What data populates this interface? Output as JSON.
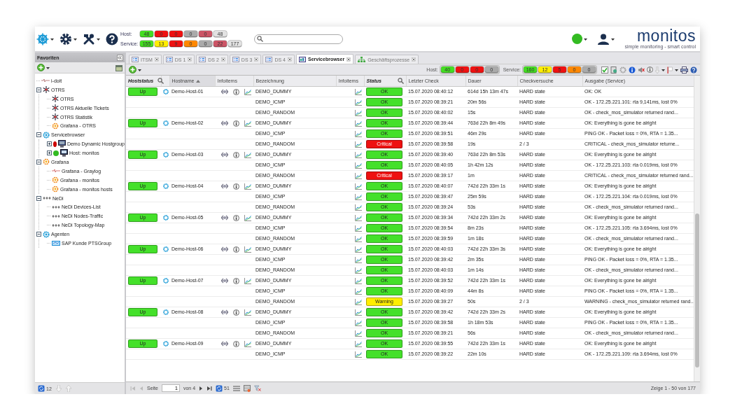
{
  "header": {
    "host_label": "Host:",
    "host_counters": [
      {
        "value": "48",
        "color": "#44dd22"
      },
      {
        "value": "0",
        "color": "#ee1111"
      },
      {
        "value": "0",
        "color": "#ee1111"
      },
      {
        "value": "0",
        "color": "#aaaaaa"
      },
      {
        "value": "0",
        "color": "#cc5566"
      },
      {
        "value": "48",
        "color": "#e2e2e2"
      }
    ],
    "service_label": "Service:",
    "service_counters": [
      {
        "value": "155",
        "color": "#44dd22"
      },
      {
        "value": "13",
        "color": "#ffee00"
      },
      {
        "value": "9",
        "color": "#ee1111"
      },
      {
        "value": "0",
        "color": "#ff8800"
      },
      {
        "value": "0",
        "color": "#aaaaaa"
      },
      {
        "value": "22",
        "color": "#cc5566"
      },
      {
        "value": "177",
        "color": "#e2e2e2"
      }
    ],
    "status": {
      "color": "#33bb22"
    },
    "logo": {
      "name": "monitos",
      "tagline": "simple monitoring - smart control"
    }
  },
  "sidebar": {
    "title": "Favoriten",
    "tree": [
      {
        "label": "i-doit",
        "kind": "idoit"
      },
      {
        "label": "OTRS",
        "kind": "otrs",
        "expanded": true,
        "children": [
          {
            "label": "OTRS",
            "kind": "otrs"
          },
          {
            "label": "OTRS Aktuelle Tickets",
            "kind": "otrs"
          },
          {
            "label": "OTRS Statistik",
            "kind": "otrs"
          },
          {
            "label": "Grafana - OTRS",
            "kind": "grafana"
          }
        ]
      },
      {
        "label": "Servicebrowser",
        "kind": "servicebrowser",
        "expanded": true,
        "children": [
          {
            "label": "Demo Dynamic Hostgroup",
            "kind": "hostgroup",
            "expanded": false,
            "color": "#cc0000"
          },
          {
            "label": "Host: monitos",
            "kind": "host",
            "expanded": false,
            "color": "#33bb22"
          }
        ]
      },
      {
        "label": "Grafana",
        "kind": "grafana",
        "expanded": true,
        "children": [
          {
            "label": "Grafana - Graylog",
            "kind": "graylog"
          },
          {
            "label": "Grafana - monitos",
            "kind": "grafana"
          },
          {
            "label": "Grafana - monitos hosts",
            "kind": "grafana"
          }
        ]
      },
      {
        "label": "NeDi",
        "kind": "nedi",
        "expanded": true,
        "children": [
          {
            "label": "NeDi Devices-List",
            "kind": "nedi"
          },
          {
            "label": "NeDi Nodes-Traffic",
            "kind": "nedi"
          },
          {
            "label": "NeDi Topology-Map",
            "kind": "nedi"
          }
        ]
      },
      {
        "label": "Agenten",
        "kind": "servicebrowser",
        "expanded": true,
        "children": [
          {
            "label": "SAP Kunde PTSGroup",
            "kind": "sap"
          }
        ]
      }
    ],
    "footer_count": "12"
  },
  "tabs": [
    {
      "label": "ITSM",
      "kind": "dashboard",
      "selected": false
    },
    {
      "label": "DS 1",
      "kind": "dashboard",
      "selected": false
    },
    {
      "label": "DS 2",
      "kind": "dashboard",
      "selected": false
    },
    {
      "label": "DS 3",
      "kind": "dashboard",
      "selected": false
    },
    {
      "label": "DS 4",
      "kind": "dashboard",
      "selected": false
    },
    {
      "label": "Servicebrowser",
      "kind": "servicebrowser",
      "selected": true
    },
    {
      "label": "Geschäftsprozesse",
      "kind": "process",
      "selected": false
    }
  ],
  "toolbar": {
    "host_label": "Host:",
    "host_counters": [
      {
        "value": "40",
        "color": "#44dd22"
      },
      {
        "value": "0",
        "color": "#ee1111"
      },
      {
        "value": "0",
        "color": "#ee1111"
      },
      {
        "value": "0",
        "color": "#aaaaaa"
      }
    ],
    "service_label": "Service:",
    "service_counters": [
      {
        "value": "160",
        "color": "#44dd22"
      },
      {
        "value": "12",
        "color": "#ffee00"
      },
      {
        "value": "5",
        "color": "#ee1111"
      },
      {
        "value": "0",
        "color": "#ff8800"
      },
      {
        "value": "0",
        "color": "#aaaaaa"
      }
    ]
  },
  "table": {
    "columns": [
      {
        "label": "Hoststatus",
        "filtered": true
      },
      {},
      {
        "label": "Hostname",
        "sorted": true
      },
      {
        "label": "Infoitems"
      },
      {
        "label": "Bezeichnung"
      },
      {
        "label": "Infoitems"
      },
      {
        "label": "Status",
        "filtered": true
      },
      {
        "label": "Letzter Check"
      },
      {
        "label": "Dauer"
      },
      {
        "label": "Checkversuche"
      },
      {
        "label": "Ausgabe (Service)"
      }
    ],
    "hosts": [
      {
        "status": "Up",
        "color": "#44e02a",
        "name": "Demo-Host-01",
        "services": [
          {
            "name": "DEMO_DUMMY",
            "status": "OK",
            "color": "#44e02a",
            "last_check": "15.07.2020 08:40:12",
            "duration": "614d 15h 13m 47s",
            "attempts": "HARD state",
            "output": "OK: OK"
          },
          {
            "name": "DEMO_ICMP",
            "status": "OK",
            "color": "#44e02a",
            "last_check": "15.07.2020 08:39:21",
            "duration": "20m 56s",
            "attempts": "HARD state",
            "output": "OK - 172.25.221.101: rta 9,141ms, lost 0%"
          },
          {
            "name": "DEMO_RANDOM",
            "status": "OK",
            "color": "#44e02a",
            "last_check": "15.07.2020 08:40:02",
            "duration": "15s",
            "attempts": "HARD state",
            "output": "OK - check_mos_simulator returned rand..."
          }
        ]
      },
      {
        "status": "Up",
        "color": "#44e02a",
        "name": "Demo-Host-02",
        "services": [
          {
            "name": "DEMO_DUMMY",
            "status": "OK",
            "color": "#44e02a",
            "last_check": "15.07.2020 08:39:44",
            "duration": "763d 22h 8m 49s",
            "attempts": "HARD state",
            "output": "OK: Everything is gone be alright"
          },
          {
            "name": "DEMO_ICMP",
            "status": "OK",
            "color": "#44e02a",
            "last_check": "15.07.2020 08:39:51",
            "duration": "46m 29s",
            "attempts": "HARD state",
            "output": "PING OK - Packet loss = 0%, RTA = 1.35..."
          },
          {
            "name": "DEMO_RANDOM",
            "status": "Critical",
            "color": "#ee1111",
            "last_check": "15.07.2020 08:39:58",
            "duration": "19s",
            "attempts": "2 / 3",
            "output": "CRITICAL - check_mos_simulator returne..."
          }
        ]
      },
      {
        "status": "Up",
        "color": "#44e02a",
        "name": "Demo-Host-03",
        "services": [
          {
            "name": "DEMO_DUMMY",
            "status": "OK",
            "color": "#44e02a",
            "last_check": "15.07.2020 08:39:40",
            "duration": "763d 22h 8m 53s",
            "attempts": "HARD state",
            "output": "OK: Everything is gone be alright"
          },
          {
            "name": "DEMO_ICMP",
            "status": "OK",
            "color": "#44e02a",
            "last_check": "15.07.2020 08:40:05",
            "duration": "1h 42m 12s",
            "attempts": "HARD state",
            "output": "OK - 172.25.221.103: rta 0.019ms, lost 0%"
          },
          {
            "name": "DEMO_RANDOM",
            "status": "Critical",
            "color": "#ee1111",
            "last_check": "15.07.2020 08:39:17",
            "duration": "1m",
            "attempts": "HARD state",
            "output": "CRITICAL - check_mos_simulator returned rand..."
          }
        ]
      },
      {
        "status": "Up",
        "color": "#44e02a",
        "name": "Demo-Host-04",
        "services": [
          {
            "name": "DEMO_DUMMY",
            "status": "OK",
            "color": "#44e02a",
            "last_check": "15.07.2020 08:40:07",
            "duration": "742d 22h 33m 1s",
            "attempts": "HARD state",
            "output": "OK: Everything is gone be alright"
          },
          {
            "name": "DEMO_ICMP",
            "status": "OK",
            "color": "#44e02a",
            "last_check": "15.07.2020 08:39:47",
            "duration": "25m 59s",
            "attempts": "HARD state",
            "output": "OK - 172.25.221.104: rta 0.019ms, lost 0%"
          },
          {
            "name": "DEMO_RANDOM",
            "status": "OK",
            "color": "#44e02a",
            "last_check": "15.07.2020 08:39:24",
            "duration": "53s",
            "attempts": "HARD state",
            "output": "OK - check_mos_simulator returned rand..."
          }
        ]
      },
      {
        "status": "Up",
        "color": "#44e02a",
        "name": "Demo-Host-05",
        "services": [
          {
            "name": "DEMO_DUMMY",
            "status": "OK",
            "color": "#44e02a",
            "last_check": "15.07.2020 08:39:34",
            "duration": "742d 22h 33m 2s",
            "attempts": "HARD state",
            "output": "OK: Everything is gone be alright"
          },
          {
            "name": "DEMO_ICMP",
            "status": "OK",
            "color": "#44e02a",
            "last_check": "15.07.2020 08:39:54",
            "duration": "8m 23s",
            "attempts": "HARD state",
            "output": "OK - 172.25.221.105: rta 3.694ms, lost 0%"
          },
          {
            "name": "DEMO_RANDOM",
            "status": "OK",
            "color": "#44e02a",
            "last_check": "15.07.2020 08:39:59",
            "duration": "1m 18s",
            "attempts": "HARD state",
            "output": "OK - check_mos_simulator returned rand..."
          }
        ]
      },
      {
        "status": "Up",
        "color": "#44e02a",
        "name": "Demo-Host-06",
        "services": [
          {
            "name": "DEMO_DUMMY",
            "status": "OK",
            "color": "#44e02a",
            "last_check": "15.07.2020 08:40:03",
            "duration": "742d 22h 33m 3s",
            "attempts": "HARD state",
            "output": "OK: Everything is gone be alright"
          },
          {
            "name": "DEMO_ICMP",
            "status": "OK",
            "color": "#44e02a",
            "last_check": "15.07.2020 08:39:42",
            "duration": "2m 35s",
            "attempts": "HARD state",
            "output": "PING OK - Packet loss = 0%, RTA = 1.35..."
          },
          {
            "name": "DEMO_RANDOM",
            "status": "OK",
            "color": "#44e02a",
            "last_check": "15.07.2020 08:40:03",
            "duration": "1m 14s",
            "attempts": "HARD state",
            "output": "OK - check_mos_simulator returned rand..."
          }
        ]
      },
      {
        "status": "Up",
        "color": "#44e02a",
        "name": "Demo-Host-07",
        "services": [
          {
            "name": "DEMO_DUMMY",
            "status": "OK",
            "color": "#44e02a",
            "last_check": "15.07.2020 08:39:52",
            "duration": "742d 22h 33m 1s",
            "attempts": "HARD state",
            "output": "OK: Everything is gone be alright"
          },
          {
            "name": "DEMO_ICMP",
            "status": "OK",
            "color": "#44e02a",
            "last_check": "15.07.2020 08:40:09",
            "duration": "44m 8s",
            "attempts": "HARD state",
            "output": "PING OK - Packet loss = 0%, RTA = 1.35..."
          },
          {
            "name": "DEMO_RANDOM",
            "status": "Warning",
            "color": "#ffee00",
            "last_check": "15.07.2020 08:39:27",
            "duration": "50s",
            "attempts": "2 / 3",
            "output": "WARNING - check_mos_simulator returned rand..."
          }
        ]
      },
      {
        "status": "Up",
        "color": "#44e02a",
        "name": "Demo-Host-08",
        "services": [
          {
            "name": "DEMO_DUMMY",
            "status": "OK",
            "color": "#44e02a",
            "last_check": "15.07.2020 08:39:42",
            "duration": "742d 22h 33m 2s",
            "attempts": "HARD state",
            "output": "OK: Everything is gone be alright"
          },
          {
            "name": "DEMO_ICMP",
            "status": "OK",
            "color": "#44e02a",
            "last_check": "15.07.2020 08:39:58",
            "duration": "1h 18m 53s",
            "attempts": "HARD state",
            "output": "PING OK - Packet loss = 0%, RTA = 1.35..."
          },
          {
            "name": "DEMO_RANDOM",
            "status": "OK",
            "color": "#44e02a",
            "last_check": "15.07.2020 08:39:21",
            "duration": "56s",
            "attempts": "HARD state",
            "output": "OK - check_mos_simulator returned rand..."
          }
        ]
      },
      {
        "status": "Up",
        "color": "#44e02a",
        "name": "Demo-Host-09",
        "services": [
          {
            "name": "DEMO_DUMMY",
            "status": "OK",
            "color": "#44e02a",
            "last_check": "15.07.2020 08:39:55",
            "duration": "742d 22h 33m 1s",
            "attempts": "HARD state",
            "output": "OK: Everything is gone be alright"
          },
          {
            "name": "DEMO_ICMP",
            "status": "OK",
            "color": "#44e02a",
            "last_check": "15.07.2020 08:39:22",
            "duration": "22m 10s",
            "attempts": "HARD state",
            "output": "OK - 172.25.221.109: rta 3.694ms, lost 0%"
          }
        ]
      }
    ]
  },
  "pager": {
    "page_label": "Seite",
    "page": "1",
    "of_label": "von 4",
    "refresh_count": "51",
    "summary": "Zeige 1 - 50 von 177"
  }
}
